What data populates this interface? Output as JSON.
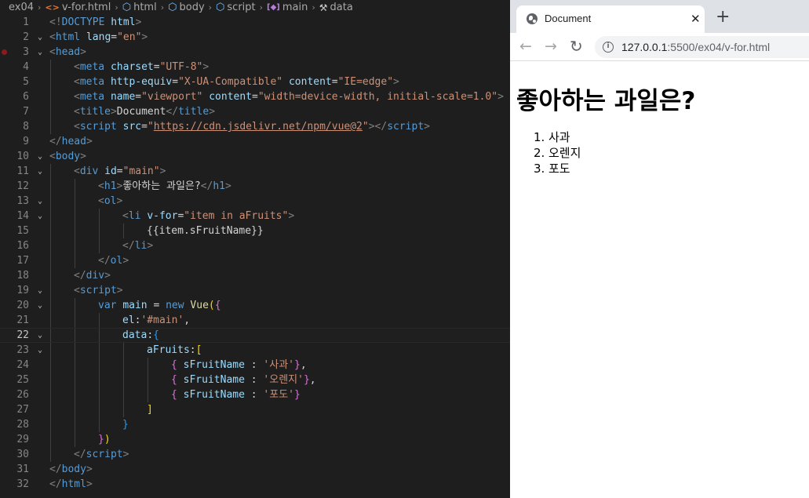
{
  "editor": {
    "breadcrumb": [
      {
        "label": "ex04",
        "icon": ""
      },
      {
        "label": "v-for.html",
        "icon": "html-file-icon"
      },
      {
        "label": "html",
        "icon": "element-cube-icon"
      },
      {
        "label": "body",
        "icon": "element-cube-icon"
      },
      {
        "label": "script",
        "icon": "element-cube-icon"
      },
      {
        "label": "main",
        "icon": "variable-bracket-icon"
      },
      {
        "label": "data",
        "icon": "wrench-icon"
      }
    ],
    "active_line": 22,
    "breakpoint_line": 3,
    "lines": [
      {
        "n": "1",
        "fold": false,
        "indent": 0,
        "tokens": [
          [
            "br",
            "<!"
          ],
          [
            "tag",
            "DOCTYPE"
          ],
          [
            "tx",
            " "
          ],
          [
            "at",
            "html"
          ],
          [
            "br",
            ">"
          ]
        ]
      },
      {
        "n": "2",
        "fold": true,
        "indent": 0,
        "tokens": [
          [
            "br",
            "<"
          ],
          [
            "tag",
            "html"
          ],
          [
            "tx",
            " "
          ],
          [
            "at",
            "lang"
          ],
          [
            "tx",
            "="
          ],
          [
            "st",
            "\"en\""
          ],
          [
            "br",
            ">"
          ]
        ]
      },
      {
        "n": "3",
        "fold": true,
        "indent": 0,
        "tokens": [
          [
            "br",
            "<"
          ],
          [
            "tag",
            "head"
          ],
          [
            "br",
            ">"
          ]
        ]
      },
      {
        "n": "4",
        "fold": false,
        "indent": 1,
        "tokens": [
          [
            "br",
            "<"
          ],
          [
            "tag",
            "meta"
          ],
          [
            "tx",
            " "
          ],
          [
            "at",
            "charset"
          ],
          [
            "tx",
            "="
          ],
          [
            "st",
            "\"UTF-8\""
          ],
          [
            "br",
            ">"
          ]
        ]
      },
      {
        "n": "5",
        "fold": false,
        "indent": 1,
        "tokens": [
          [
            "br",
            "<"
          ],
          [
            "tag",
            "meta"
          ],
          [
            "tx",
            " "
          ],
          [
            "at",
            "http-equiv"
          ],
          [
            "tx",
            "="
          ],
          [
            "st",
            "\"X-UA-Compatible\""
          ],
          [
            "tx",
            " "
          ],
          [
            "at",
            "content"
          ],
          [
            "tx",
            "="
          ],
          [
            "st",
            "\"IE=edge\""
          ],
          [
            "br",
            ">"
          ]
        ]
      },
      {
        "n": "6",
        "fold": false,
        "indent": 1,
        "tokens": [
          [
            "br",
            "<"
          ],
          [
            "tag",
            "meta"
          ],
          [
            "tx",
            " "
          ],
          [
            "at",
            "name"
          ],
          [
            "tx",
            "="
          ],
          [
            "st",
            "\"viewport\""
          ],
          [
            "tx",
            " "
          ],
          [
            "at",
            "content"
          ],
          [
            "tx",
            "="
          ],
          [
            "st",
            "\"width=device-width, initial-scale=1.0\""
          ],
          [
            "br",
            ">"
          ]
        ]
      },
      {
        "n": "7",
        "fold": false,
        "indent": 1,
        "tokens": [
          [
            "br",
            "<"
          ],
          [
            "tag",
            "title"
          ],
          [
            "br",
            ">"
          ],
          [
            "tx",
            "Document"
          ],
          [
            "br",
            "</"
          ],
          [
            "tag",
            "title"
          ],
          [
            "br",
            ">"
          ]
        ]
      },
      {
        "n": "8",
        "fold": false,
        "indent": 1,
        "tokens": [
          [
            "br",
            "<"
          ],
          [
            "tag",
            "script"
          ],
          [
            "tx",
            " "
          ],
          [
            "at",
            "src"
          ],
          [
            "tx",
            "="
          ],
          [
            "st",
            "\""
          ],
          [
            "url",
            "https://cdn.jsdelivr.net/npm/vue@2"
          ],
          [
            "st",
            "\""
          ],
          [
            "br",
            "></"
          ],
          [
            "tag",
            "script"
          ],
          [
            "br",
            ">"
          ]
        ]
      },
      {
        "n": "9",
        "fold": false,
        "indent": 0,
        "tokens": [
          [
            "br",
            "</"
          ],
          [
            "tag",
            "head"
          ],
          [
            "br",
            ">"
          ]
        ]
      },
      {
        "n": "10",
        "fold": true,
        "indent": 0,
        "tokens": [
          [
            "br",
            "<"
          ],
          [
            "tag",
            "body"
          ],
          [
            "br",
            ">"
          ]
        ]
      },
      {
        "n": "11",
        "fold": true,
        "indent": 1,
        "tokens": [
          [
            "br",
            "<"
          ],
          [
            "tag",
            "div"
          ],
          [
            "tx",
            " "
          ],
          [
            "at",
            "id"
          ],
          [
            "tx",
            "="
          ],
          [
            "st",
            "\"main\""
          ],
          [
            "br",
            ">"
          ]
        ]
      },
      {
        "n": "12",
        "fold": false,
        "indent": 2,
        "tokens": [
          [
            "br",
            "<"
          ],
          [
            "tag",
            "h1"
          ],
          [
            "br",
            ">"
          ],
          [
            "tx",
            "좋아하는 과일은?"
          ],
          [
            "br",
            "</"
          ],
          [
            "tag",
            "h1"
          ],
          [
            "br",
            ">"
          ]
        ]
      },
      {
        "n": "13",
        "fold": true,
        "indent": 2,
        "tokens": [
          [
            "br",
            "<"
          ],
          [
            "tag",
            "ol"
          ],
          [
            "br",
            ">"
          ]
        ]
      },
      {
        "n": "14",
        "fold": true,
        "indent": 3,
        "tokens": [
          [
            "br",
            "<"
          ],
          [
            "tag",
            "li"
          ],
          [
            "tx",
            " "
          ],
          [
            "at",
            "v-for"
          ],
          [
            "tx",
            "="
          ],
          [
            "st",
            "\"item in aFruits\""
          ],
          [
            "br",
            ">"
          ]
        ]
      },
      {
        "n": "15",
        "fold": false,
        "indent": 4,
        "tokens": [
          [
            "tx",
            "{{item.sFruitName}}"
          ]
        ]
      },
      {
        "n": "16",
        "fold": false,
        "indent": 3,
        "tokens": [
          [
            "br",
            "</"
          ],
          [
            "tag",
            "li"
          ],
          [
            "br",
            ">"
          ]
        ]
      },
      {
        "n": "17",
        "fold": false,
        "indent": 2,
        "tokens": [
          [
            "br",
            "</"
          ],
          [
            "tag",
            "ol"
          ],
          [
            "br",
            ">"
          ]
        ]
      },
      {
        "n": "18",
        "fold": false,
        "indent": 1,
        "tokens": [
          [
            "br",
            "</"
          ],
          [
            "tag",
            "div"
          ],
          [
            "br",
            ">"
          ]
        ]
      },
      {
        "n": "19",
        "fold": true,
        "indent": 1,
        "tokens": [
          [
            "br",
            "<"
          ],
          [
            "tag",
            "script"
          ],
          [
            "br",
            ">"
          ]
        ]
      },
      {
        "n": "20",
        "fold": true,
        "indent": 2,
        "tokens": [
          [
            "kw",
            "var"
          ],
          [
            "tx",
            " "
          ],
          [
            "at",
            "main"
          ],
          [
            "tx",
            " = "
          ],
          [
            "kw",
            "new"
          ],
          [
            "tx",
            " "
          ],
          [
            "fn",
            "Vue"
          ],
          [
            "p1",
            "("
          ],
          [
            "p2",
            "{"
          ]
        ]
      },
      {
        "n": "21",
        "fold": false,
        "indent": 3,
        "tokens": [
          [
            "at",
            "el"
          ],
          [
            "tx",
            ":"
          ],
          [
            "st",
            "'#main'"
          ],
          [
            "tx",
            ","
          ]
        ]
      },
      {
        "n": "22",
        "fold": true,
        "indent": 3,
        "tokens": [
          [
            "at",
            "data"
          ],
          [
            "tx",
            ":"
          ],
          [
            "p3",
            "{"
          ]
        ]
      },
      {
        "n": "23",
        "fold": true,
        "indent": 4,
        "tokens": [
          [
            "at",
            "aFruits"
          ],
          [
            "tx",
            ":"
          ],
          [
            "p1",
            "["
          ]
        ]
      },
      {
        "n": "24",
        "fold": false,
        "indent": 5,
        "tokens": [
          [
            "p2",
            "{"
          ],
          [
            "tx",
            " "
          ],
          [
            "at",
            "sFruitName"
          ],
          [
            "tx",
            " : "
          ],
          [
            "st",
            "'사과'"
          ],
          [
            "p2",
            "}"
          ],
          [
            "tx",
            ","
          ]
        ]
      },
      {
        "n": "25",
        "fold": false,
        "indent": 5,
        "tokens": [
          [
            "p2",
            "{"
          ],
          [
            "tx",
            " "
          ],
          [
            "at",
            "sFruitName"
          ],
          [
            "tx",
            " : "
          ],
          [
            "st",
            "'오렌지'"
          ],
          [
            "p2",
            "}"
          ],
          [
            "tx",
            ","
          ]
        ]
      },
      {
        "n": "26",
        "fold": false,
        "indent": 5,
        "tokens": [
          [
            "p2",
            "{"
          ],
          [
            "tx",
            " "
          ],
          [
            "at",
            "sFruitName"
          ],
          [
            "tx",
            " : "
          ],
          [
            "st",
            "'포도'"
          ],
          [
            "p2",
            "}"
          ]
        ]
      },
      {
        "n": "27",
        "fold": false,
        "indent": 4,
        "tokens": [
          [
            "p1",
            "]"
          ]
        ]
      },
      {
        "n": "28",
        "fold": false,
        "indent": 3,
        "tokens": [
          [
            "p3",
            "}"
          ]
        ]
      },
      {
        "n": "29",
        "fold": false,
        "indent": 2,
        "tokens": [
          [
            "p2",
            "}"
          ],
          [
            "p1",
            ")"
          ]
        ]
      },
      {
        "n": "30",
        "fold": false,
        "indent": 1,
        "tokens": [
          [
            "br",
            "</"
          ],
          [
            "tag",
            "script"
          ],
          [
            "br",
            ">"
          ]
        ]
      },
      {
        "n": "31",
        "fold": false,
        "indent": 0,
        "tokens": [
          [
            "br",
            "</"
          ],
          [
            "tag",
            "body"
          ],
          [
            "br",
            ">"
          ]
        ]
      },
      {
        "n": "32",
        "fold": false,
        "indent": 0,
        "tokens": [
          [
            "br",
            "</"
          ],
          [
            "tag",
            "html"
          ],
          [
            "br",
            ">"
          ]
        ]
      }
    ]
  },
  "browser": {
    "tab_title": "Document",
    "tab_close": "✕",
    "new_tab": "+",
    "back": "←",
    "forward": "→",
    "reload": "↻",
    "info_icon": "i",
    "url_host": "127.0.0.1",
    "url_path": ":5500/ex04/v-for.html",
    "page": {
      "heading": "좋아하는 과일은?",
      "items": [
        {
          "num": "1.",
          "label": "사과"
        },
        {
          "num": "2.",
          "label": "오렌지"
        },
        {
          "num": "3.",
          "label": "포도"
        }
      ]
    }
  },
  "colors": {
    "editor_bg": "#1e1e1e",
    "tag": "#569cd6",
    "attr": "#9cdcfe",
    "string": "#ce9178",
    "text": "#d4d4d4",
    "func": "#dcdcaa",
    "bracket_gold": "#ffd700",
    "bracket_purple": "#da70d6",
    "bracket_blue": "#179fff"
  }
}
